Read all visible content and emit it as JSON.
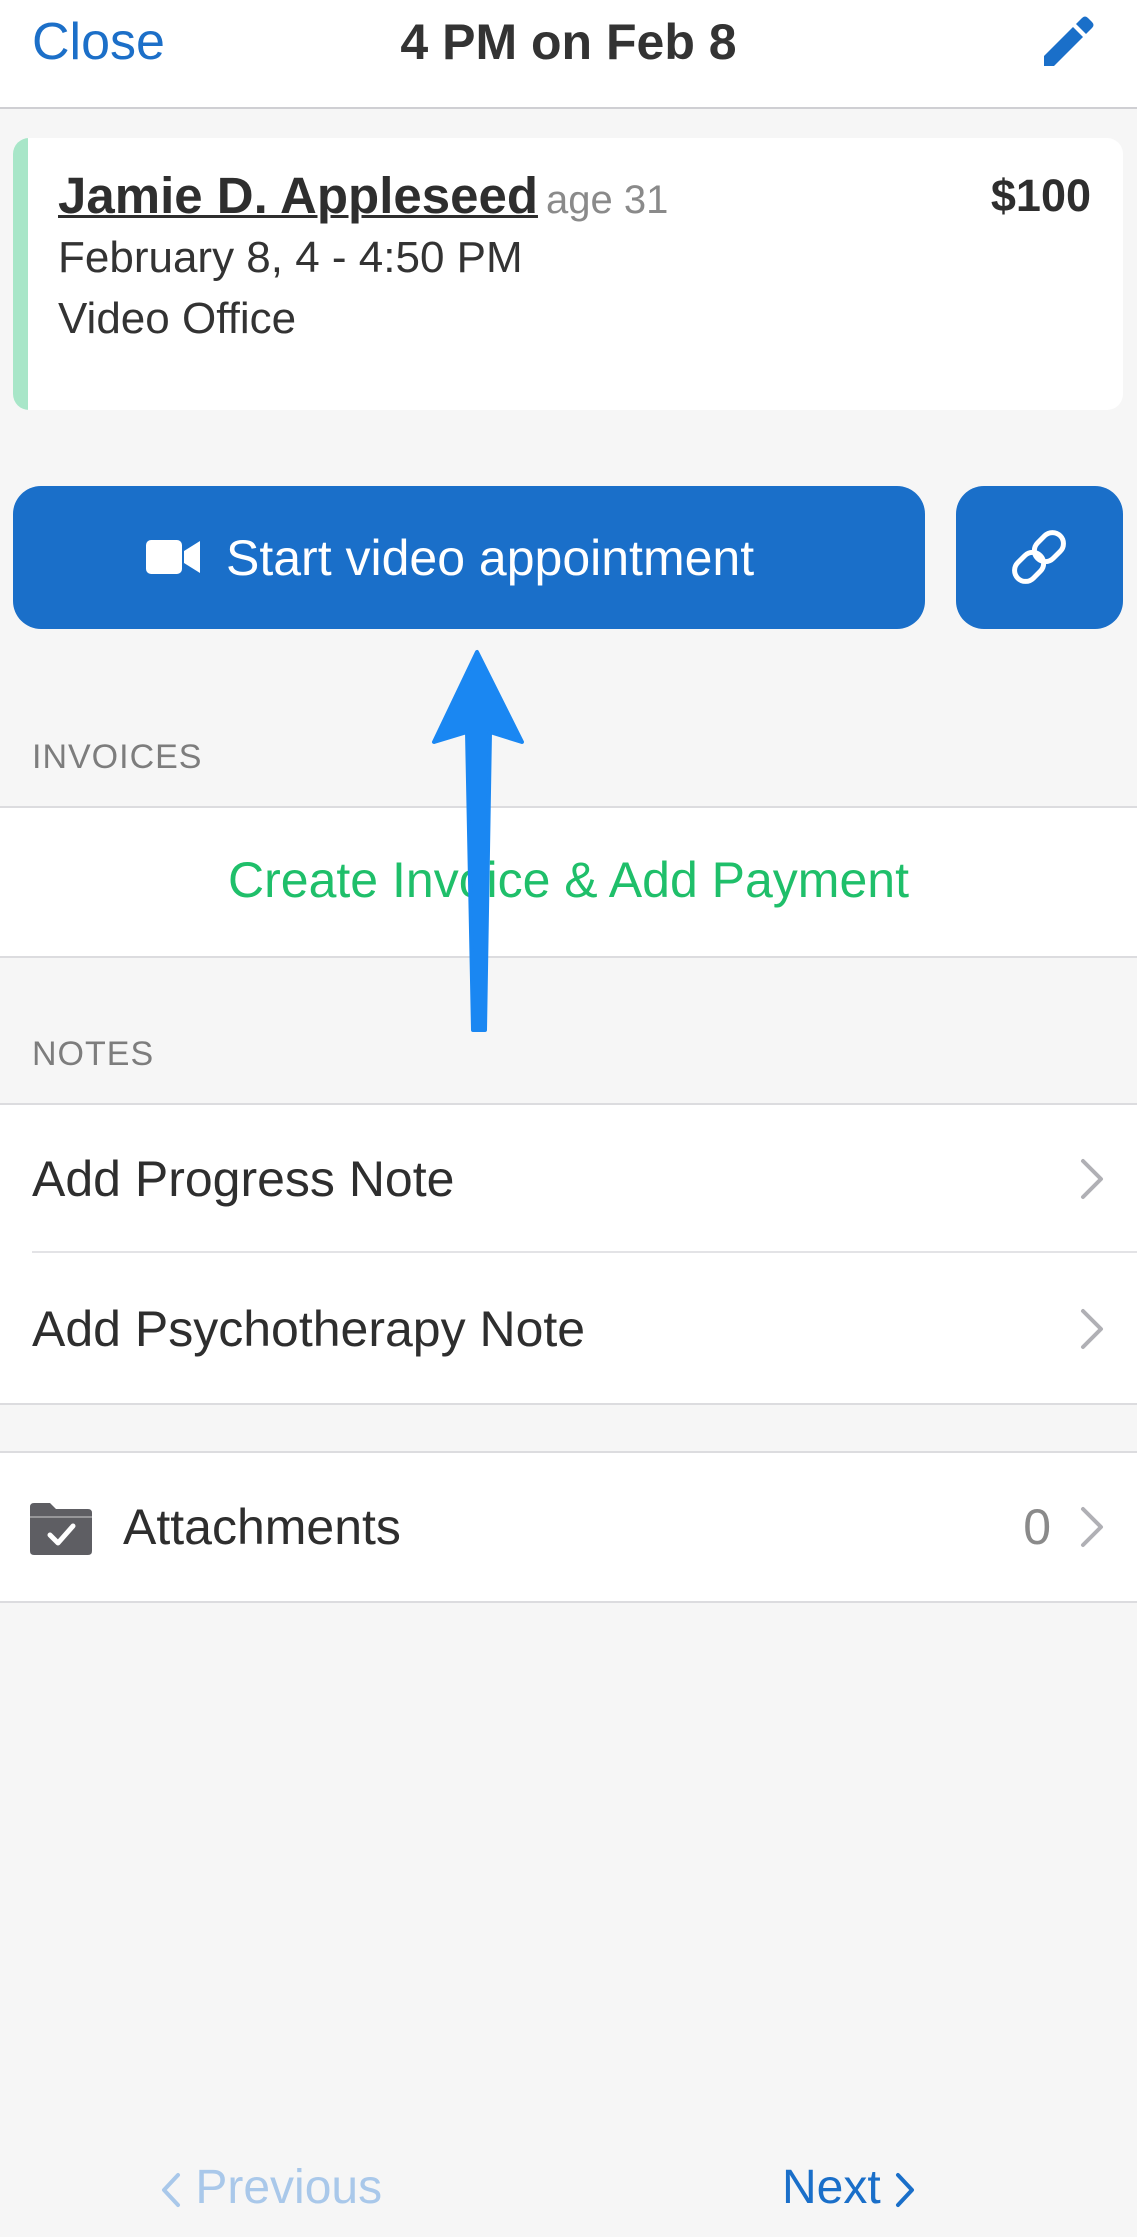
{
  "navbar": {
    "close_label": "Close",
    "title": "4 PM on Feb 8",
    "edit_icon": "pencil-icon"
  },
  "appointment": {
    "client_name": "Jamie D. Appleseed",
    "client_age": "age 31",
    "date_time": "February 8, 4 - 4:50 PM",
    "location": "Video Office",
    "price": "$100",
    "accent_color": "#a8e6c8"
  },
  "actions": {
    "start_video_label": "Start video appointment",
    "video_icon": "video-camera-icon",
    "link_icon": "link-icon",
    "button_color": "#1a6fc9"
  },
  "invoices": {
    "header": "INVOICES",
    "create_label": "Create Invoice & Add Payment",
    "action_color": "#1fbf6a"
  },
  "notes": {
    "header": "NOTES",
    "items": [
      {
        "label": "Add Progress Note"
      },
      {
        "label": "Add Psychotherapy Note"
      }
    ]
  },
  "attachments": {
    "label": "Attachments",
    "count": "0",
    "icon": "folder-check-icon"
  },
  "footer": {
    "previous_label": "Previous",
    "next_label": "Next"
  }
}
